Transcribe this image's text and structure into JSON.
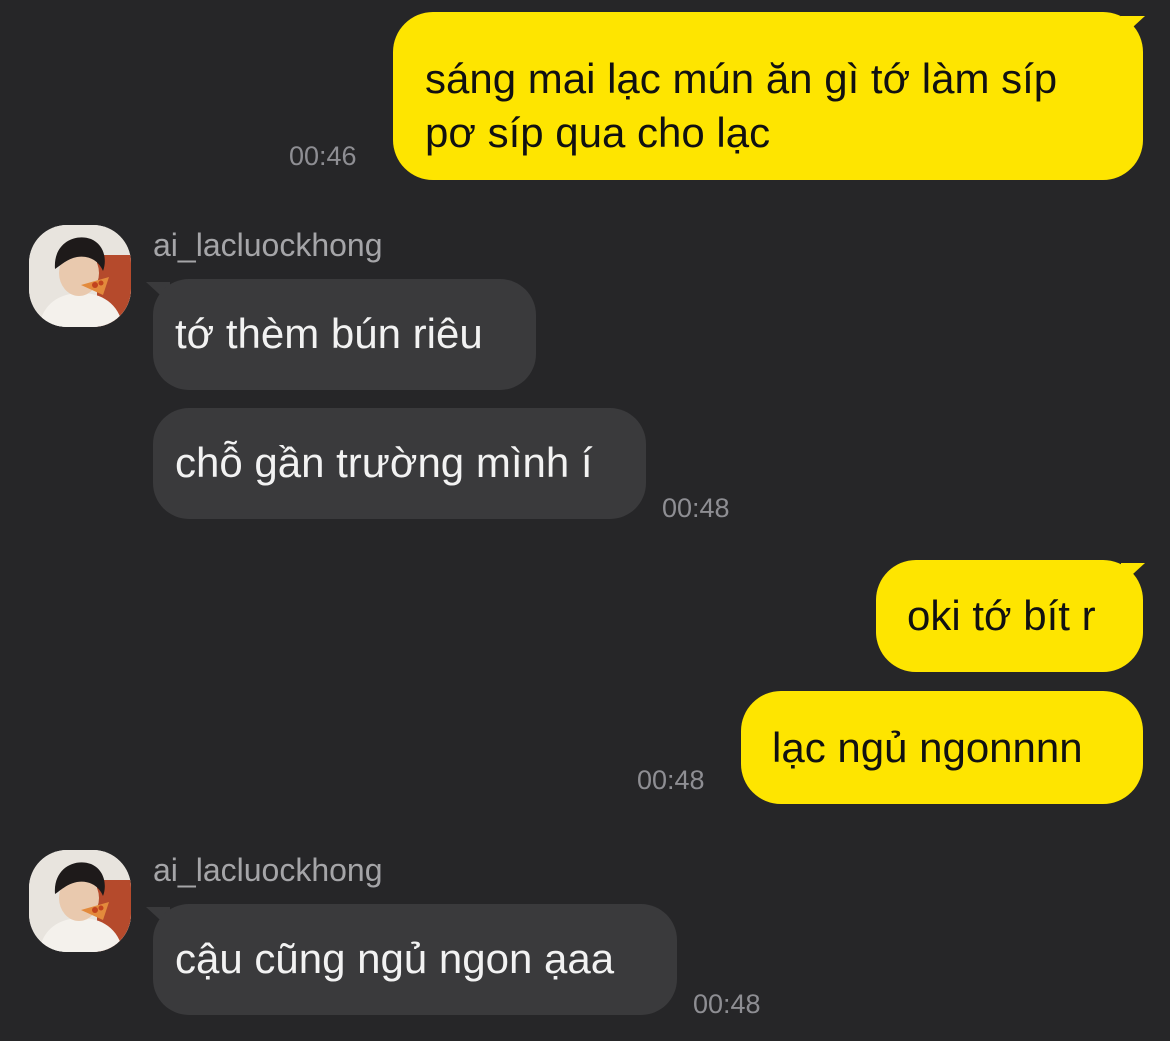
{
  "conversation": {
    "messages": [
      {
        "sender": "me",
        "text": "sáng mai lạc mún ăn gì tớ làm síp\npơ síp qua cho lạc",
        "time": "00:46"
      },
      {
        "sender": "ai_lacluockhong",
        "text": "tớ thèm bún riêu",
        "time": ""
      },
      {
        "sender": "ai_lacluockhong",
        "text": "chỗ gần trường mình í",
        "time": "00:48"
      },
      {
        "sender": "me",
        "text": "oki tớ bít r",
        "time": ""
      },
      {
        "sender": "me",
        "text": "lạc ngủ ngonnnn",
        "time": "00:48"
      },
      {
        "sender": "ai_lacluockhong",
        "text": "cậu cũng ngủ ngon ạaa",
        "time": "00:48"
      }
    ],
    "sender_names": [
      "ai_lacluockhong",
      "ai_lacluockhong"
    ]
  },
  "colors": {
    "background": "#262628",
    "outgoing_bubble": "#FEE500",
    "incoming_bubble": "#3A3A3C",
    "timestamp": "#8E8E93"
  },
  "icons": {
    "avatar": "profile-photo"
  }
}
